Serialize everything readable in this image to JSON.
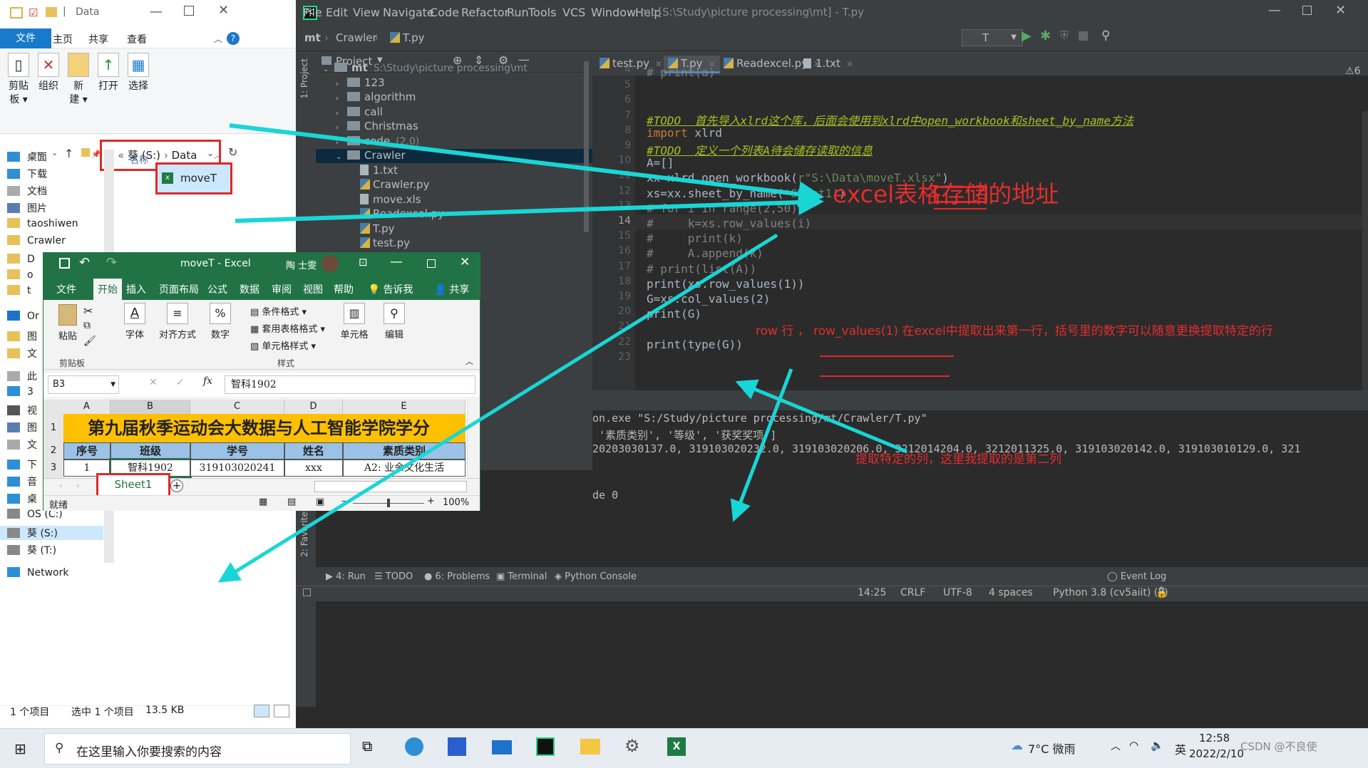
{
  "explorer": {
    "address_path": [
      "葵 (S:)",
      "Data"
    ],
    "menu_tabs": [
      "文件",
      "主页",
      "共享",
      "查看"
    ],
    "ribbon": [
      {
        "label": "剪贴\n板 ▾",
        "icon": "clipboard-icon"
      },
      {
        "label": "组织",
        "icon": "organize-icon"
      },
      {
        "label": "新\n建 ▾",
        "icon": "new-folder-icon"
      },
      {
        "label": "打开",
        "icon": "open-icon"
      },
      {
        "label": "选择",
        "icon": "select-icon"
      }
    ],
    "nav_items": [
      "桌面",
      "下载",
      "文档",
      "图片",
      "taoshiwen",
      "Crawler",
      "D",
      "o",
      "t",
      "Or",
      "图",
      "文",
      "此",
      "3",
      "视",
      "图",
      "文",
      "下",
      "音",
      "桌",
      "OS (C:)",
      "葵 (S:)",
      "葵 (T:)",
      "Network"
    ],
    "column_header": "名称",
    "files": [
      "moveT"
    ],
    "status": {
      "count": "1 个项目",
      "selected": "选中 1 个项目",
      "size": "13.5 KB"
    }
  },
  "pycharm": {
    "menu": [
      "File",
      "Edit",
      "View",
      "Navigate",
      "Code",
      "Refactor",
      "Run",
      "Tools",
      "VCS",
      "Window",
      "Help"
    ],
    "window_title": "mt [S:\\Study\\picture processing\\mt] - T.py",
    "breadcrumb": [
      "mt",
      "Crawler",
      "T.py"
    ],
    "run_config": "T",
    "project_panel_title": "Project",
    "side_label": "1: Project",
    "favorites_label": "2: Favorites",
    "tree": [
      {
        "name": "mt",
        "extra": "S:\\Study\\picture processing\\mt",
        "type": "folder",
        "indent": 0,
        "open": true
      },
      {
        "name": "123",
        "type": "folder",
        "indent": 1
      },
      {
        "name": "algorithm",
        "type": "folder",
        "indent": 1
      },
      {
        "name": "call",
        "type": "folder",
        "indent": 1
      },
      {
        "name": "Christmas",
        "type": "folder",
        "indent": 1
      },
      {
        "name": "code",
        "extra": "(2.0)",
        "type": "folder",
        "indent": 1
      },
      {
        "name": "Crawler",
        "type": "folder",
        "indent": 1,
        "open": true,
        "selected": true
      },
      {
        "name": "1.txt",
        "type": "file",
        "indent": 2
      },
      {
        "name": "Crawler.py",
        "type": "py",
        "indent": 2
      },
      {
        "name": "move.xls",
        "type": "file",
        "indent": 2
      },
      {
        "name": "Readexcel.py",
        "type": "py",
        "indent": 2
      },
      {
        "name": "T.py",
        "type": "py",
        "indent": 2
      },
      {
        "name": "test.py",
        "type": "py",
        "indent": 2
      }
    ],
    "tabs": [
      "test.py",
      "T.py",
      "Readexcel.py",
      "1.txt"
    ],
    "active_tab": "T.py",
    "warning_count": "6",
    "code": [
      {
        "n": "4",
        "t": "# print(a)",
        "c": "cm"
      },
      {
        "n": "5",
        "t": "",
        "c": ""
      },
      {
        "n": "6",
        "t": "",
        "c": ""
      },
      {
        "n": "7",
        "t": "#TODO  首先导入xlrd这个库，后面会使用到xlrd中open_workbook和sheet_by_name方法",
        "c": "todo"
      },
      {
        "n": "8",
        "t": "import xlrd",
        "c": "kwline"
      },
      {
        "n": "9",
        "t": "#TODO  定义一个列表A待会储存读取的信息",
        "c": "todo"
      },
      {
        "n": "10",
        "t": "A=[]",
        "c": ""
      },
      {
        "n": "11",
        "t": "xx=xlrd.open_workbook(r\"S:\\Data\\moveT.xlsx\")",
        "c": "strline"
      },
      {
        "n": "12",
        "t": "xs=xx.sheet_by_name('Sheet1')",
        "c": "strline"
      },
      {
        "n": "13",
        "t": "# for i in range(2,50):",
        "c": "cm"
      },
      {
        "n": "14",
        "t": "#     k=xs.row_values(i)",
        "c": "cm"
      },
      {
        "n": "15",
        "t": "#     print(k)",
        "c": "cm"
      },
      {
        "n": "16",
        "t": "#     A.append(k)",
        "c": "cm"
      },
      {
        "n": "17",
        "t": "# print(list(A))",
        "c": "cm"
      },
      {
        "n": "18",
        "t": "print(xs.row_values(1))",
        "c": ""
      },
      {
        "n": "19",
        "t": "G=xs.col_values(2)",
        "c": ""
      },
      {
        "n": "20",
        "t": "print(G)",
        "c": ""
      },
      {
        "n": "21",
        "t": "",
        "c": ""
      },
      {
        "n": "22",
        "t": "print(type(G))",
        "c": ""
      },
      {
        "n": "23",
        "t": "",
        "c": ""
      }
    ],
    "output": [
      "on.exe \"S:/Study/picture processing/mt/Crawler/T.py\"",
      " '素质类别', '等级', '获奖奖项']",
      "20203030137.0, 319103020232.0, 319103020206.0, 3212014204.0, 3212011325.0, 319103020142.0, 319103010129.0, 321",
      "",
      "",
      "de 0"
    ],
    "toolwindows": [
      "4: Run",
      "TODO",
      "6: Problems",
      "Terminal",
      "Python Console",
      "Event Log"
    ],
    "status": {
      "pos": "14:25",
      "eol": "CRLF",
      "enc": "UTF-8",
      "indent": "4 spaces",
      "interp": "Python 3.8 (cv5aiit) (2)"
    }
  },
  "excel": {
    "title": "moveT  -  Excel",
    "user": "陶 士雯",
    "menu": [
      "文件",
      "开始",
      "插入",
      "页面布局",
      "公式",
      "数据",
      "审阅",
      "视图",
      "帮助",
      "告诉我",
      "共享"
    ],
    "ribbon_groups": [
      "粘贴",
      "字体",
      "对齐方式",
      "数字",
      "条件格式 ▾",
      "套用表格格式 ▾",
      "单元格样式 ▾",
      "单元格",
      "编辑"
    ],
    "group_labels": [
      "剪贴板",
      "样式"
    ],
    "name_box": "B3",
    "formula": "智科1902",
    "columns": [
      "A",
      "B",
      "C",
      "D",
      "E"
    ],
    "row1": "第九届秋季运动会大数据与人工智能学院学分",
    "headers": [
      "序号",
      "班级",
      "学号",
      "姓名",
      "素质类别"
    ],
    "row3": [
      "1",
      "智科1902",
      "319103020241",
      "xxx",
      "A2: 业余文化生活"
    ],
    "sheet": "Sheet1",
    "status_left": "就绪",
    "zoom": "100%"
  },
  "annotations": {
    "excel_path_note": "excel表格存储的地址",
    "row_note": "row  行  ， row_values(1) 在excel中提取出来第一行，括号里的数字可以随意更换提取特定的行",
    "col_note": "提取特定的列，这里我提取的是第二列"
  },
  "taskbar": {
    "search_placeholder": "在这里输入你要搜索的内容",
    "weather": "7°C 微雨",
    "ime": "英",
    "time": "12:58",
    "date": "2022/2/10",
    "watermark": "CSDN @不良使"
  },
  "colors": {
    "pycharm_bg": "#2b2b2b",
    "excel_green": "#217346",
    "annotation_red": "#e32d2d",
    "arrow_cyan": "#19d6d6"
  }
}
